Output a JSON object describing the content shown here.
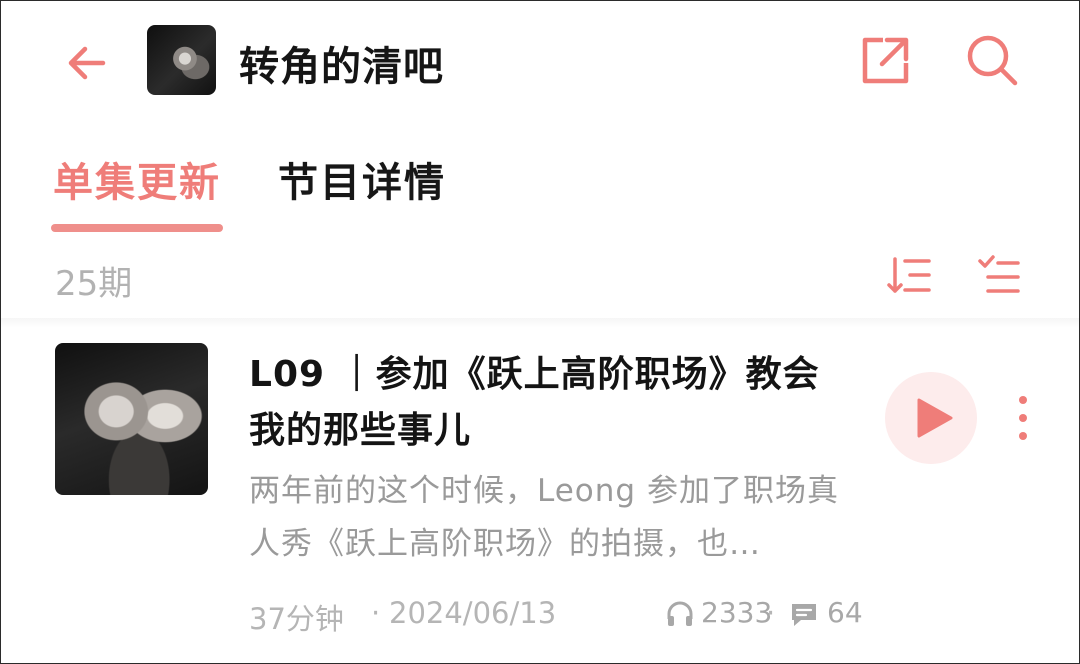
{
  "header": {
    "back_icon": "arrow-left-icon",
    "title": "转角的清吧",
    "share_icon": "share-icon",
    "search_icon": "search-icon",
    "accent_color": "#ef7d79"
  },
  "tabs": [
    {
      "label": "单集更新",
      "active": true
    },
    {
      "label": "节目详情",
      "active": false
    }
  ],
  "episode_count": "25期",
  "toolbar": {
    "sort_icon": "sort-icon",
    "select_icon": "list-select-icon"
  },
  "episodes": [
    {
      "title": "L09 ｜参加《跃上高阶职场》教会我的那些事儿",
      "description": "两年前的这个时候，Leong 参加了职场真人秀《跃上高阶职场》的拍摄，也…",
      "duration": "37分钟",
      "separator": "·",
      "date": "2024/06/13",
      "listens": "2333",
      "comments": "64",
      "play_icon": "play-icon",
      "more_icon": "more-vertical-icon"
    }
  ]
}
